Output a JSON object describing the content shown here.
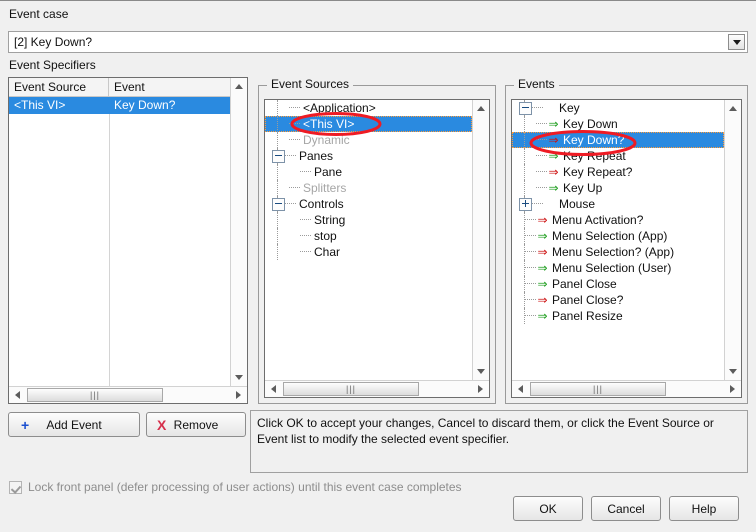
{
  "dialog": {
    "event_case_label": "Event case",
    "event_case_value": "[2] Key Down?",
    "specifiers_label": "Event Specifiers"
  },
  "colors": {
    "selection_blue": "#2a8ae0",
    "annotation_red": "#ee1b24",
    "notify_arrow_green": "#1e9d1e",
    "filter_arrow_red": "#cc1111",
    "add_plus_blue": "#1a4fd0",
    "remove_x_red": "#d62f4b",
    "window_bg": "#f0f0f0",
    "disabled_gray": "#a6a6a6"
  },
  "specifiers": {
    "columns": [
      "Event Source",
      "Event"
    ],
    "rows": [
      {
        "source": "<This VI>",
        "event": "Key Down?",
        "selected": true
      }
    ]
  },
  "event_sources": {
    "title": "Event Sources",
    "nodes": [
      {
        "label": "<Application>",
        "indent": 1,
        "twisty": "none",
        "state": "normal"
      },
      {
        "label": "<This VI>",
        "indent": 1,
        "twisty": "none",
        "state": "selected",
        "annotated": true
      },
      {
        "label": "Dynamic",
        "indent": 1,
        "twisty": "none",
        "state": "disabled"
      },
      {
        "label": "Panes",
        "indent": 0,
        "twisty": "minus",
        "state": "normal"
      },
      {
        "label": "Pane",
        "indent": 2,
        "twisty": "none",
        "state": "normal"
      },
      {
        "label": "Splitters",
        "indent": 1,
        "twisty": "none",
        "state": "disabled"
      },
      {
        "label": "Controls",
        "indent": 0,
        "twisty": "minus",
        "state": "normal"
      },
      {
        "label": "String",
        "indent": 2,
        "twisty": "none",
        "state": "normal"
      },
      {
        "label": "stop",
        "indent": 2,
        "twisty": "none",
        "state": "normal"
      },
      {
        "label": "Char",
        "indent": 2,
        "twisty": "none",
        "state": "normal"
      }
    ]
  },
  "events": {
    "title": "Events",
    "nodes": [
      {
        "label": "Key",
        "indent": 0,
        "twisty": "minus",
        "arrow": "none",
        "state": "normal"
      },
      {
        "label": "Key Down",
        "indent": 1,
        "twisty": "none",
        "arrow": "notify",
        "state": "normal"
      },
      {
        "label": "Key Down?",
        "indent": 1,
        "twisty": "none",
        "arrow": "filter",
        "state": "selected",
        "annotated": true
      },
      {
        "label": "Key Repeat",
        "indent": 1,
        "twisty": "none",
        "arrow": "notify",
        "state": "normal"
      },
      {
        "label": "Key Repeat?",
        "indent": 1,
        "twisty": "none",
        "arrow": "filter",
        "state": "normal"
      },
      {
        "label": "Key Up",
        "indent": 1,
        "twisty": "none",
        "arrow": "notify",
        "state": "normal"
      },
      {
        "label": "Mouse",
        "indent": 0,
        "twisty": "plus",
        "arrow": "none",
        "state": "normal"
      },
      {
        "label": "Menu Activation?",
        "indent": 0,
        "twisty": "none",
        "arrow": "filter",
        "state": "normal"
      },
      {
        "label": "Menu Selection (App)",
        "indent": 0,
        "twisty": "none",
        "arrow": "notify",
        "state": "normal"
      },
      {
        "label": "Menu Selection? (App)",
        "indent": 0,
        "twisty": "none",
        "arrow": "filter",
        "state": "normal"
      },
      {
        "label": "Menu Selection (User)",
        "indent": 0,
        "twisty": "none",
        "arrow": "notify",
        "state": "normal"
      },
      {
        "label": "Panel Close",
        "indent": 0,
        "twisty": "none",
        "arrow": "notify",
        "state": "normal"
      },
      {
        "label": "Panel Close?",
        "indent": 0,
        "twisty": "none",
        "arrow": "filter",
        "state": "normal"
      },
      {
        "label": "Panel Resize",
        "indent": 0,
        "twisty": "none",
        "arrow": "notify",
        "state": "normal"
      }
    ]
  },
  "buttons": {
    "add_event": "Add Event",
    "add_event_glyph": "+",
    "remove": "Remove",
    "remove_glyph": "X",
    "ok": "OK",
    "cancel": "Cancel",
    "help": "Help"
  },
  "hint": {
    "text": "Click OK to accept your changes, Cancel to discard them, or click the Event Source or Event list to modify the selected event specifier."
  },
  "lock_front_panel": {
    "label": "Lock front panel (defer processing of user actions) until this event case completes",
    "checked": true,
    "enabled": false
  }
}
